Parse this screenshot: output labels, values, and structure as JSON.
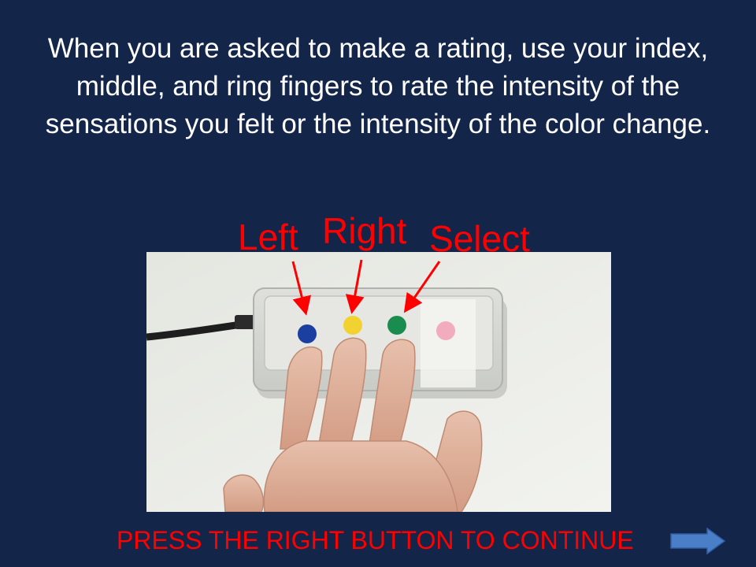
{
  "slide": {
    "instruction": "When you are asked to make a rating, use your index, middle, and ring fingers to rate the intensity of the sensations you felt or the intensity of the color change.",
    "labels": {
      "left": "Left",
      "right": "Right",
      "select": "Select"
    },
    "photo": {
      "buttons": [
        "blue",
        "yellow",
        "green",
        "pink"
      ],
      "colors": {
        "blue": "#1a3fa0",
        "yellow": "#f2d230",
        "green": "#1a8c4e",
        "pink": "#f07e9e"
      }
    },
    "continue_prompt": "PRESS THE RIGHT BUTTON TO CONTINUE",
    "next_icon": "right-arrow-icon"
  },
  "colors": {
    "background": "#13264a",
    "text": "#ffffff",
    "accent": "#ff0000",
    "arrow_fill": "#4a7fc8"
  }
}
